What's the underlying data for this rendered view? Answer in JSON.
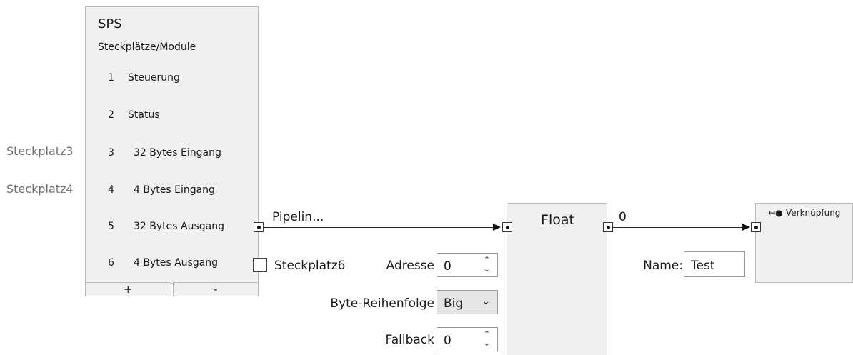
{
  "sps": {
    "title": "SPS",
    "subtitle": "Steckplätze/Module",
    "slots": [
      {
        "num": "1",
        "name": "Steuerung"
      },
      {
        "num": "2",
        "name": "Status"
      },
      {
        "num": "3",
        "name": "32 Bytes Eingang"
      },
      {
        "num": "4",
        "name": "4 Bytes Eingang"
      },
      {
        "num": "5",
        "name": "32 Bytes Ausgang"
      },
      {
        "num": "6",
        "name": "4 Bytes Ausgang"
      }
    ],
    "add_label": "+",
    "remove_label": "-"
  },
  "side_labels": {
    "slot3": "Steckplatz3",
    "slot4": "Steckplatz4"
  },
  "connections": {
    "pipeline_label": "Pipelin...",
    "checkbox_label": "Steckplatz6",
    "float_output_label": "0"
  },
  "float_node": {
    "title": "Float",
    "address_label": "Adresse",
    "address_value": "0",
    "byte_order_label": "Byte-Reihenfolge",
    "byte_order_value": "Big",
    "fallback_label": "Fallback",
    "fallback_value": "0"
  },
  "link_node": {
    "title": "Verknüpfung",
    "name_label": "Name:",
    "name_value": "Test"
  },
  "icons": {
    "spin_up": "chevron-up-icon",
    "spin_down": "chevron-down-icon",
    "select": "chevron-down-icon",
    "link": "link-arrow-icon"
  }
}
